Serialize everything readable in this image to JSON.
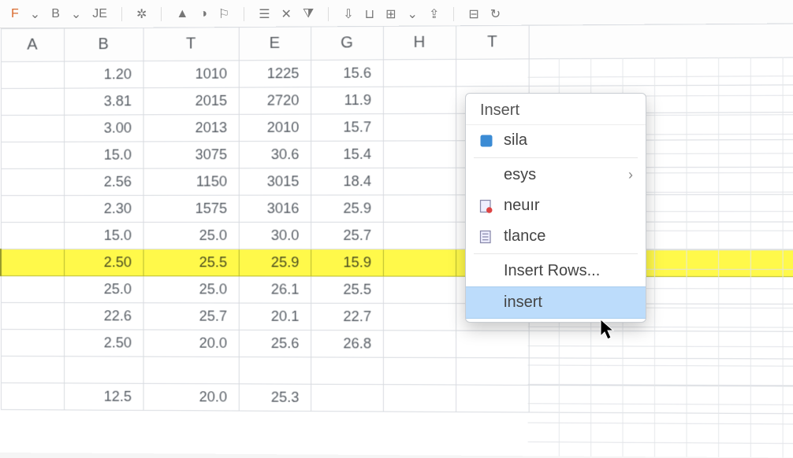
{
  "toolbar": {
    "f_label": "F",
    "bold": "B",
    "underline": "JE"
  },
  "columns": [
    "A",
    "B",
    "T",
    "E",
    "G",
    "H",
    "T",
    "",
    "",
    ""
  ],
  "rows": [
    {
      "b": "1.20",
      "t": "1010",
      "e": "1225",
      "g": "15.6"
    },
    {
      "b": "3.81",
      "t": "2015",
      "e": "2720",
      "g": "11.9"
    },
    {
      "b": "3.00",
      "t": "2013",
      "e": "2010",
      "g": "15.7"
    },
    {
      "b": "15.0",
      "t": "3075",
      "e": "30.6",
      "g": "15.4"
    },
    {
      "b": "2.56",
      "t": "1150",
      "e": "3015",
      "g": "18.4"
    },
    {
      "b": "2.30",
      "t": "1575",
      "e": "3016",
      "g": "25.9"
    },
    {
      "b": "15.0",
      "t": "25.0",
      "e": "30.0",
      "g": "25.7"
    },
    {
      "b": "2.50",
      "t": "25.5",
      "e": "25.9",
      "g": "15.9",
      "highlight": true
    },
    {
      "b": "25.0",
      "t": "25.0",
      "e": "26.1",
      "g": "25.5"
    },
    {
      "b": "22.6",
      "t": "25.7",
      "e": "20.1",
      "g": "22.7"
    },
    {
      "b": "2.50",
      "t": "20.0",
      "e": "25.6",
      "g": "26.8"
    },
    {
      "b": "",
      "t": "",
      "e": "",
      "g": ""
    },
    {
      "b": "12.5",
      "t": "20.0",
      "e": "25.3",
      "g": ""
    }
  ],
  "menu": {
    "title": "Insert",
    "items": [
      {
        "icon": "file-blue",
        "label": "sila"
      },
      {
        "icon": "",
        "label": "esys",
        "sub": "›"
      },
      {
        "icon": "file-red",
        "label": "neuır"
      },
      {
        "icon": "file-lines",
        "label": "tlance"
      },
      {
        "icon": "",
        "label": "Insert Rows..."
      },
      {
        "icon": "",
        "label": "insert",
        "hover": true
      }
    ]
  }
}
